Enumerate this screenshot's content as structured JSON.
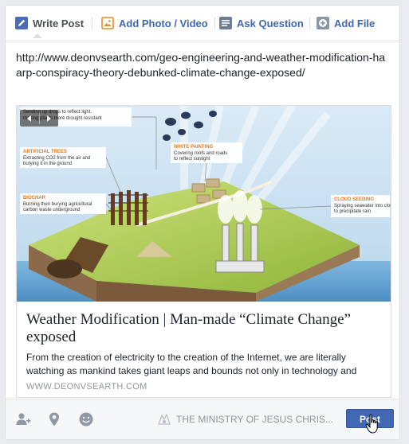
{
  "tabs": [
    {
      "label": "Write Post",
      "icon": "pencil-icon",
      "active": true
    },
    {
      "label": "Add Photo / Video",
      "icon": "photo-icon",
      "active": false
    },
    {
      "label": "Ask Question",
      "icon": "list-icon",
      "active": false
    },
    {
      "label": "Add File",
      "icon": "plus-box-icon",
      "active": false
    }
  ],
  "post": {
    "text": "http://www.deonvsearth.com/geo-engineering-and-weather-modification-haarp-conspiracy-theory-debunked-climate-change-exposed/"
  },
  "preview": {
    "title": "Weather Modification | Man-made “Climate Change” exposed",
    "description": "From the creation of electricity to the creation of the Internet, we are literally watching as mankind takes giant leaps and bounds not only in technology and",
    "domain": "WWW.DEONVSEARTH.COM",
    "image_labels": {
      "top_left": "Sending up drops to reflect light, making plants more drought resistant",
      "artificial_trees_title": "ARTIFICIAL TREES",
      "artificial_trees_text": "Extracting CO2 from the air and burying it in the ground",
      "biochar_title": "BIOCHAR",
      "biochar_text": "Burning then burying agricultural carbon waste underground",
      "white_painting_title": "WHITE PAINTING",
      "white_painting_text": "Covering roofs and roads to reflect sunlight",
      "cloud_seeding_title": "CLOUD SEEDING",
      "cloud_seeding_text": "Spraying seawater into clouds to precipitate rain"
    }
  },
  "footer": {
    "audience": "THE MINISTRY OF JESUS CHRIS...",
    "post_label": "Post"
  },
  "colors": {
    "brand_blue": "#4267b2",
    "background": "#e9ebee",
    "text": "#1d2129",
    "muted": "#90949c"
  }
}
